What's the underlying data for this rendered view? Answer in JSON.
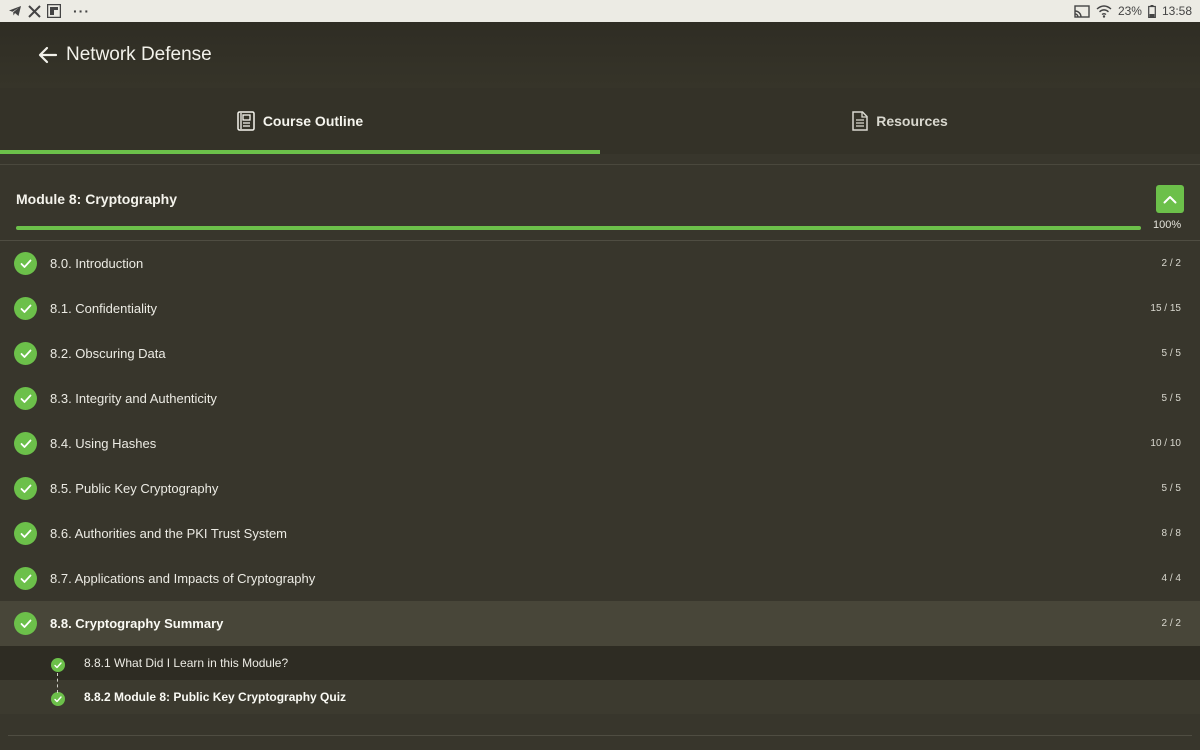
{
  "status_bar": {
    "battery": "23%",
    "time": "13:58"
  },
  "header": {
    "title": "Network Defense"
  },
  "tabs": [
    {
      "label": "Course Outline",
      "icon": "outline-icon",
      "active": true
    },
    {
      "label": "Resources",
      "icon": "document-icon",
      "active": false
    }
  ],
  "module": {
    "title": "Module 8: Cryptography",
    "progress_percent": 100,
    "progress_label": "100%"
  },
  "sections": [
    {
      "label": "8.0. Introduction",
      "count": "2 / 2"
    },
    {
      "label": "8.1. Confidentiality",
      "count": "15 / 15"
    },
    {
      "label": "8.2. Obscuring Data",
      "count": "5 / 5"
    },
    {
      "label": "8.3. Integrity and Authenticity",
      "count": "5 / 5"
    },
    {
      "label": "8.4. Using Hashes",
      "count": "10 / 10"
    },
    {
      "label": "8.5. Public Key Cryptography",
      "count": "5 / 5"
    },
    {
      "label": "8.6. Authorities and the PKI Trust System",
      "count": "8 / 8"
    },
    {
      "label": "8.7. Applications and Impacts of Cryptography",
      "count": "4 / 4"
    },
    {
      "label": "8.8. Cryptography Summary",
      "count": "2 / 2"
    }
  ],
  "subsections": [
    {
      "label": "8.8.1 What Did I Learn in this Module?"
    },
    {
      "label": "8.8.2 Module 8: Public Key Cryptography Quiz"
    }
  ],
  "colors": {
    "accent": "#6cc04a",
    "background": "#38362c"
  }
}
